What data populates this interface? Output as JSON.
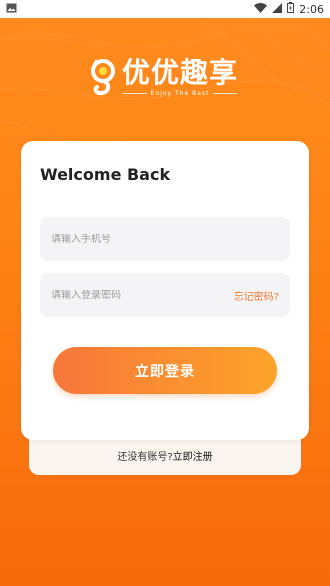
{
  "status_bar": {
    "time": "2:06",
    "icons": [
      "image-icon",
      "wifi-icon",
      "signal-icon",
      "battery-icon"
    ]
  },
  "brand": {
    "title": "优优趣享",
    "tagline": "Enjoy The Best",
    "background_color": "#ff8616",
    "accent_color": "#f07a2a"
  },
  "login": {
    "heading": "Welcome Back",
    "phone_placeholder": "请输入手机号",
    "password_placeholder": "请输入登录密码",
    "forgot_password": "忘记密码?",
    "submit_label": "立即登录"
  },
  "register": {
    "prompt": "还没有账号?",
    "link": "立即注册"
  }
}
